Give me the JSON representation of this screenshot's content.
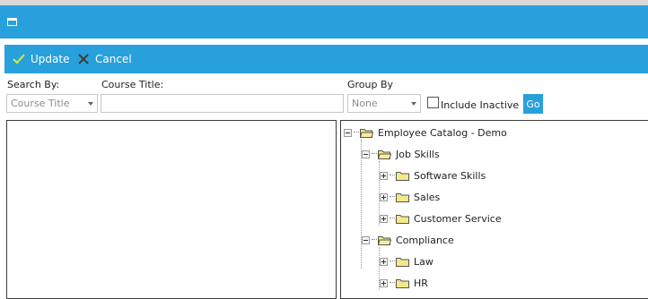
{
  "toolbar": {
    "update_label": "Update",
    "cancel_label": "Cancel"
  },
  "search": {
    "search_by_label": "Search By:",
    "search_by_value": "Course Title",
    "course_title_label": "Course Title:",
    "course_title_value": "",
    "group_by_label": "Group By",
    "group_by_value": "None",
    "include_inactive_label": "Include Inactive",
    "include_inactive_checked": false,
    "go_label": "Go"
  },
  "tree": {
    "root": "Employee Catalog - Demo",
    "job_skills": "Job Skills",
    "software_skills": "Software Skills",
    "sales": "Sales",
    "customer_service": "Customer Service",
    "compliance": "Compliance",
    "law": "Law",
    "hr": "HR"
  },
  "colors": {
    "accent": "#27a0dc",
    "folder": "#f3e98a"
  }
}
